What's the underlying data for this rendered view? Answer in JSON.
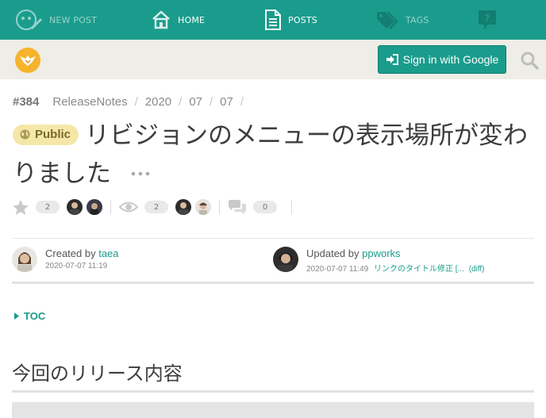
{
  "nav": {
    "new_post": "NEW POST",
    "home": "HOME",
    "posts": "POSTS",
    "tags": "TAGS",
    "help_icon": "question-bubble-icon"
  },
  "header": {
    "signin_label": "Sign in with Google",
    "search_icon": "search-icon"
  },
  "post": {
    "number": "#384",
    "breadcrumbs": [
      "ReleaseNotes",
      "2020",
      "07",
      "07"
    ],
    "visibility": "Public",
    "title": "リビジョンのメニューの表示場所が変わりました",
    "stars_count": "2",
    "watchers_count": "2",
    "comments_count": "0"
  },
  "created": {
    "prefix": "Created by",
    "user": "taea",
    "date": "2020-07-07 11:19"
  },
  "updated": {
    "prefix": "Updated by",
    "user": "ppworks",
    "date": "2020-07-07 11:49",
    "message": "リンクのタイトル修正 [...",
    "diff": "(diff)"
  },
  "toc_label": "TOC",
  "section_heading": "今回のリリース内容",
  "colors": {
    "accent": "#1a9c8c",
    "badge": "#f5e7a8",
    "logo": "#f6b42c",
    "subbar": "#eeede6"
  }
}
